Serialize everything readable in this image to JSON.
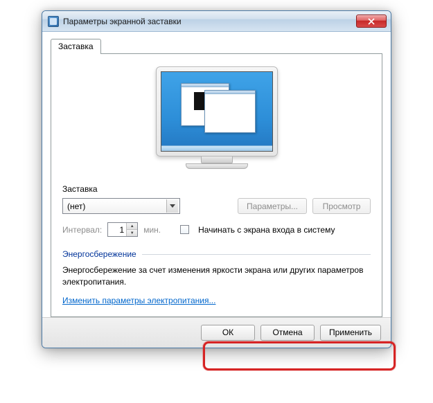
{
  "window": {
    "title": "Параметры экранной заставки"
  },
  "tabs": {
    "screensaver": "Заставка"
  },
  "section": {
    "screensaver_label": "Заставка",
    "dropdown_value": "(нет)",
    "settings_btn": "Параметры...",
    "preview_btn": "Просмотр",
    "interval_label": "Интервал:",
    "interval_value": "1",
    "interval_unit": "мин.",
    "on_resume_label": "Начинать с экрана входа в систему"
  },
  "power": {
    "group_label": "Энергосбережение",
    "description": "Энергосбережение за счет изменения яркости экрана или других параметров электропитания.",
    "link": "Изменить параметры электропитания..."
  },
  "footer": {
    "ok": "ОК",
    "cancel": "Отмена",
    "apply": "Применить"
  }
}
